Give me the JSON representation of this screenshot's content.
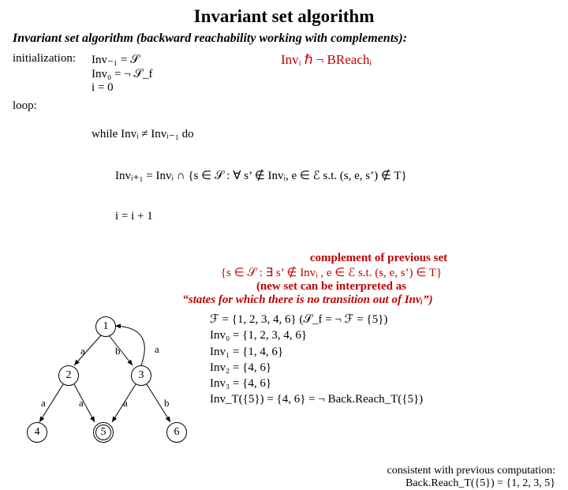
{
  "title": "Invariant set algorithm",
  "subtitle": "Invariant set algorithm (backward reachability working with complements):",
  "init": {
    "label": "initialization:",
    "l1": "Inv₋₁ = 𝒮",
    "l2": "Inv₀ = ¬ 𝒮_f",
    "l3": "i = 0",
    "rel": "Invᵢ ℏ ¬ BReachᵢ"
  },
  "loop": {
    "label": "loop:",
    "l1": "while Invᵢ ≠ Invᵢ₋₁ do",
    "l2": "        Invᵢ₊₁ = Invᵢ ∩ {s ∈ 𝒮 : ∀ s’ ∉ Invᵢ, e ∈ ℰ s.t. (s, e, s’) ∉ T}",
    "l3": "        i = i + 1"
  },
  "comp": {
    "h": "complement of previous set",
    "s": "{s ∈ 𝒮 : ∃ s’ ∉ Invᵢ , e ∈ ℰ s.t. (s, e, s’) ∈ T}",
    "n1": "(new set can be interpreted as",
    "n2": "“states for which there is no transition out of Invᵢ”)"
  },
  "edge": {
    "a": "a",
    "b": "b"
  },
  "node": {
    "n1": "1",
    "n2": "2",
    "n3": "3",
    "n4": "4",
    "n5": "5",
    "n6": "6"
  },
  "res": {
    "l1": "ℱ = {1, 2, 3, 4, 6}  (𝒮_f = ¬ ℱ = {5})",
    "l2": "Inv₀ = {1, 2, 3, 4, 6}",
    "l3": "Inv₁ = {1, 4, 6}",
    "l4": "Inv₂ =  {4, 6}",
    "l5": "Inv₃ = {4, 6}",
    "l6": "Inv_T({5}) = {4, 6} = ¬ Back.Reach_T({5})"
  },
  "footer": {
    "l1": "consistent with previous computation:",
    "l2": "Back.Reach_T({5}) = {1, 2, 3, 5}"
  },
  "chart_data": {
    "type": "graph",
    "nodes": [
      1,
      2,
      3,
      4,
      5,
      6
    ],
    "final_nodes": [
      5
    ],
    "edges": [
      {
        "from": 1,
        "to": 2,
        "label": "a"
      },
      {
        "from": 1,
        "to": 3,
        "label": "b"
      },
      {
        "from": 3,
        "to": 1,
        "label": "a"
      },
      {
        "from": 2,
        "to": 4,
        "label": "a"
      },
      {
        "from": 2,
        "to": 5,
        "label": "a"
      },
      {
        "from": 3,
        "to": 5,
        "label": "a"
      },
      {
        "from": 3,
        "to": 6,
        "label": "b"
      }
    ]
  }
}
